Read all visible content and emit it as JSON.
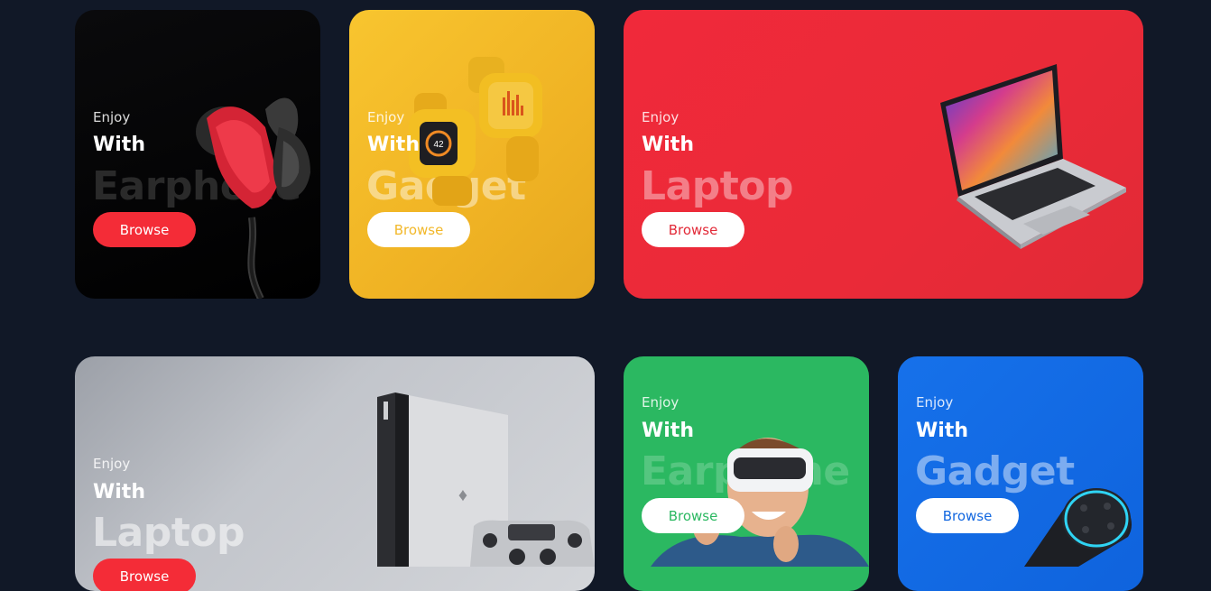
{
  "cards": [
    {
      "enjoy": "Enjoy",
      "with": "With",
      "title": "Earphone",
      "button": "Browse"
    },
    {
      "enjoy": "Enjoy",
      "with": "With",
      "title": "Gadget",
      "button": "Browse"
    },
    {
      "enjoy": "Enjoy",
      "with": "With",
      "title": "Laptop",
      "button": "Browse"
    },
    {
      "enjoy": "Enjoy",
      "with": "With",
      "title": "Laptop",
      "button": "Browse"
    },
    {
      "enjoy": "Enjoy",
      "with": "With",
      "title": "Earphone",
      "button": "Browse"
    },
    {
      "enjoy": "Enjoy",
      "with": "With",
      "title": "Gadget",
      "button": "Browse"
    }
  ],
  "colors": {
    "page_background": "#111827",
    "earphone_card": "#000000",
    "gadget_card": "#f8c52f",
    "laptop_card": "#ea2a38",
    "console_card": "#c2c5cb",
    "vr_card": "#2bb861",
    "speaker_card": "#1671ea",
    "accent_red": "#f42c37"
  },
  "icons": [
    "earphone-image",
    "smartwatch-image",
    "laptop-image",
    "console-image",
    "vr-headset-image",
    "smart-speaker-image"
  ]
}
